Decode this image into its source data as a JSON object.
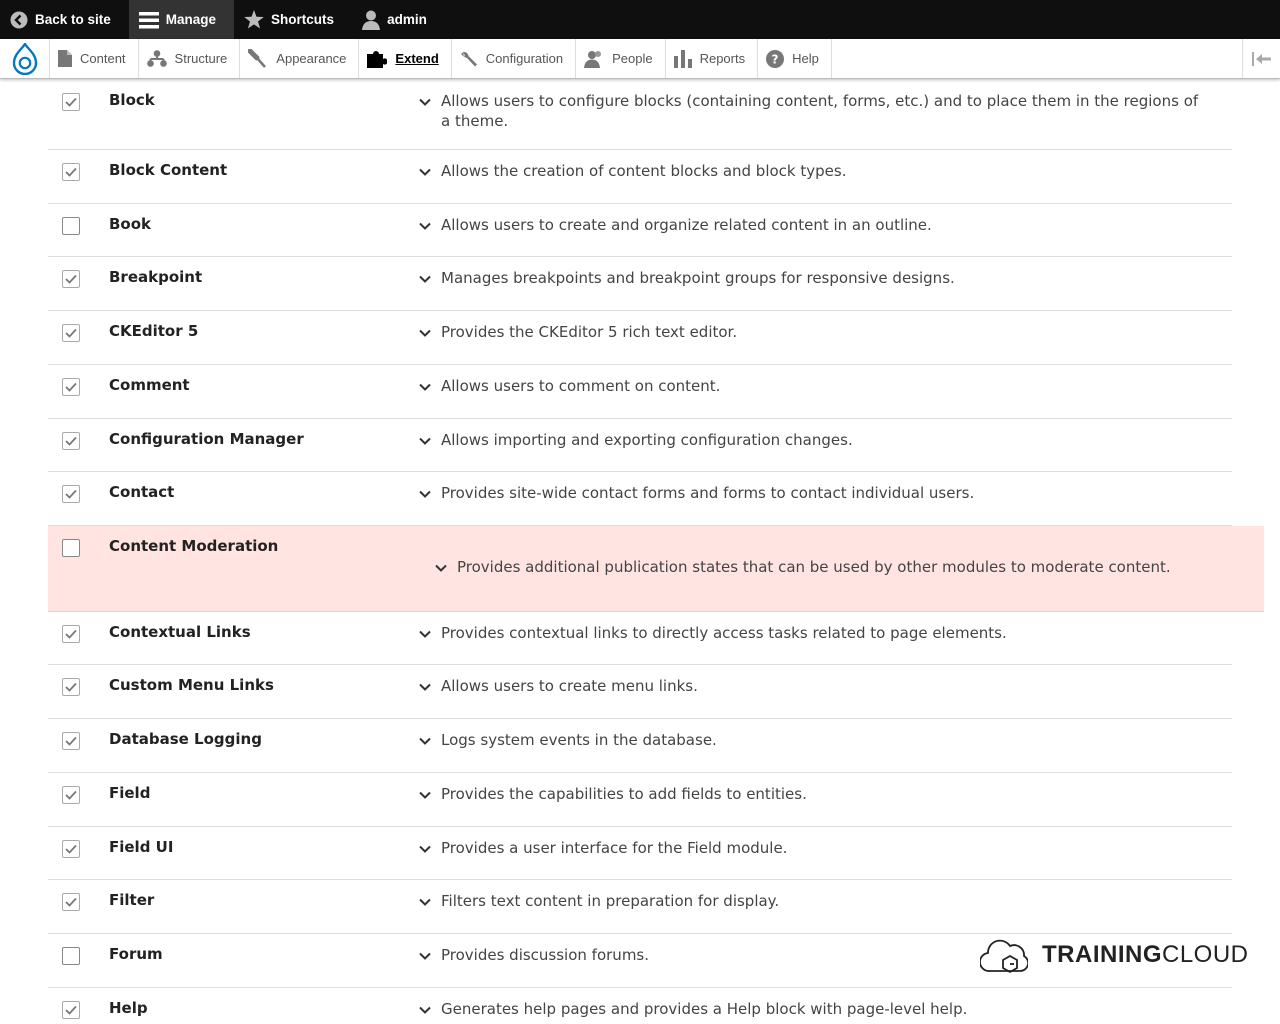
{
  "toolbar": {
    "back_to_site": "Back to site",
    "manage": "Manage",
    "shortcuts": "Shortcuts",
    "user": "admin"
  },
  "tray": {
    "items": [
      {
        "label": "Content",
        "icon": "file-icon"
      },
      {
        "label": "Structure",
        "icon": "sitemap-icon"
      },
      {
        "label": "Appearance",
        "icon": "paintbrush-icon"
      },
      {
        "label": "Extend",
        "icon": "puzzle-icon",
        "active": true
      },
      {
        "label": "Configuration",
        "icon": "wrench-icon"
      },
      {
        "label": "People",
        "icon": "people-icon"
      },
      {
        "label": "Reports",
        "icon": "bar-chart-icon"
      },
      {
        "label": "Help",
        "icon": "question-icon"
      }
    ]
  },
  "modules": [
    {
      "name": "Block",
      "checked": true,
      "description": "Allows users to configure blocks (containing content, forms, etc.) and to place them in the regions of a theme."
    },
    {
      "name": "Block Content",
      "checked": true,
      "description": "Allows the creation of content blocks and block types."
    },
    {
      "name": "Book",
      "checked": false,
      "description": "Allows users to create and organize related content in an outline."
    },
    {
      "name": "Breakpoint",
      "checked": true,
      "description": "Manages breakpoints and breakpoint groups for responsive designs."
    },
    {
      "name": "CKEditor 5",
      "checked": true,
      "description": "Provides the CKEditor 5 rich text editor."
    },
    {
      "name": "Comment",
      "checked": true,
      "description": "Allows users to comment on content."
    },
    {
      "name": "Configuration Manager",
      "checked": true,
      "description": "Allows importing and exporting configuration changes."
    },
    {
      "name": "Contact",
      "checked": true,
      "description": "Provides site-wide contact forms and forms to contact individual users."
    },
    {
      "name": "Content Moderation",
      "checked": false,
      "highlight": true,
      "description": "Provides additional publication states that can be used by other modules to moderate content."
    },
    {
      "name": "Contextual Links",
      "checked": true,
      "description": "Provides contextual links to directly access tasks related to page elements."
    },
    {
      "name": "Custom Menu Links",
      "checked": true,
      "description": "Allows users to create menu links."
    },
    {
      "name": "Database Logging",
      "checked": true,
      "description": "Logs system events in the database."
    },
    {
      "name": "Field",
      "checked": true,
      "description": "Provides the capabilities to add fields to entities."
    },
    {
      "name": "Field UI",
      "checked": true,
      "description": "Provides a user interface for the Field module."
    },
    {
      "name": "Filter",
      "checked": true,
      "description": "Filters text content in preparation for display."
    },
    {
      "name": "Forum",
      "checked": false,
      "description": "Provides discussion forums."
    },
    {
      "name": "Help",
      "checked": true,
      "description": "Generates help pages and provides a Help block with page-level help."
    }
  ],
  "watermark": {
    "bold": "TRAINING",
    "regular": "CLOUD"
  },
  "colors": {
    "highlight": "#ffe4e1",
    "toolbar": "#0f0f0f",
    "drupal_blue": "#0678be"
  }
}
